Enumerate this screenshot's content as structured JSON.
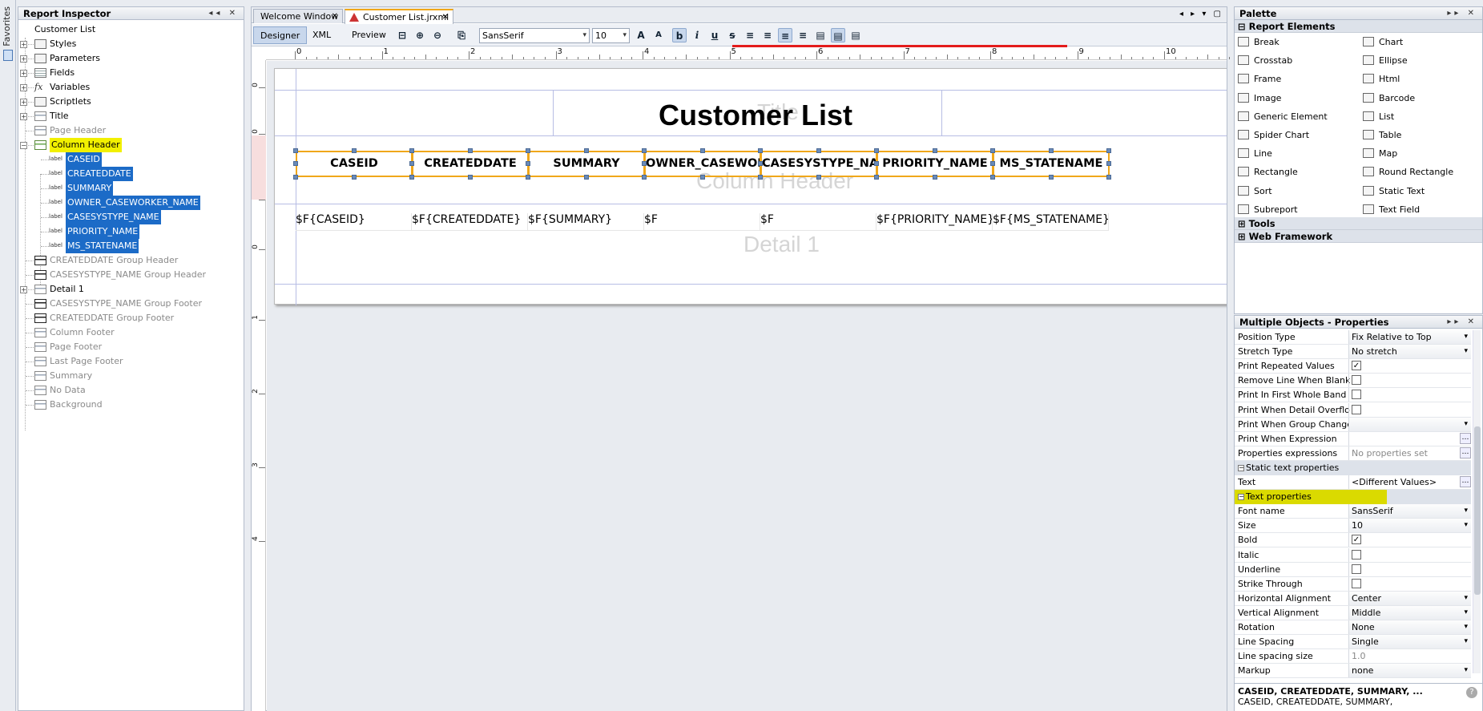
{
  "favorites": {
    "label": "Favorites"
  },
  "inspector": {
    "title": "Report Inspector",
    "items": [
      {
        "label": "Customer List"
      },
      {
        "label": "Styles"
      },
      {
        "label": "Parameters"
      },
      {
        "label": "Fields"
      },
      {
        "label": "Variables"
      },
      {
        "label": "Scriptlets"
      },
      {
        "label": "Title"
      },
      {
        "label": "Page Header"
      },
      {
        "label": "Column Header"
      },
      {
        "label": "CASEID"
      },
      {
        "label": "CREATEDDATE"
      },
      {
        "label": "SUMMARY"
      },
      {
        "label": "OWNER_CASEWORKER_NAME"
      },
      {
        "label": "CASESYSTYPE_NAME"
      },
      {
        "label": "PRIORITY_NAME"
      },
      {
        "label": "MS_STATENAME"
      },
      {
        "label": "CREATEDDATE Group Header"
      },
      {
        "label": "CASESYSTYPE_NAME Group Header"
      },
      {
        "label": "Detail 1"
      },
      {
        "label": "CASESYSTYPE_NAME Group Footer"
      },
      {
        "label": "CREATEDDATE Group Footer"
      },
      {
        "label": "Column Footer"
      },
      {
        "label": "Page Footer"
      },
      {
        "label": "Last Page Footer"
      },
      {
        "label": "Summary"
      },
      {
        "label": "No Data"
      },
      {
        "label": "Background"
      }
    ],
    "element_type_label": "label",
    "fx_label": "fx"
  },
  "editor": {
    "tabs": [
      {
        "label": "Welcome Window"
      },
      {
        "label": "Customer List.jrxml"
      }
    ],
    "modes": {
      "designer": "Designer",
      "xml": "XML",
      "preview": "Preview"
    },
    "font_name": "SansSerif",
    "font_size": "10",
    "ruler_h": [
      "0",
      "1",
      "2",
      "3",
      "4",
      "5",
      "6",
      "7",
      "8",
      "9",
      "10"
    ],
    "ruler_v": [
      "0",
      "0",
      "0",
      "0",
      "1",
      "2",
      "3",
      "4"
    ],
    "report_title": "Customer List",
    "watermarks": {
      "title": "Title",
      "column_header": "Column Header",
      "detail": "Detail 1"
    },
    "column_headers": [
      "CASEID",
      "CREATEDDATE",
      "SUMMARY",
      "OWNER_CASEWORKER_NAME",
      "CASESYSTYPE_NAME",
      "PRIORITY_NAME",
      "MS_STATENAME"
    ],
    "detail_fields": [
      "$F{CASEID}",
      "$F{CREATEDDATE}",
      "$F{SUMMARY}",
      "$F",
      "$F",
      "$F{PRIORITY_NAME}",
      "$F{MS_STATENAME}"
    ]
  },
  "palette": {
    "title": "Palette",
    "category": "Report Elements",
    "items": [
      {
        "label": "Break",
        "icon": "break-icon"
      },
      {
        "label": "Chart",
        "icon": "chart-icon"
      },
      {
        "label": "Crosstab",
        "icon": "crosstab-icon"
      },
      {
        "label": "Ellipse",
        "icon": "ellipse-icon"
      },
      {
        "label": "Frame",
        "icon": "frame-icon"
      },
      {
        "label": "Html",
        "icon": "html-icon"
      },
      {
        "label": "Image",
        "icon": "image-icon"
      },
      {
        "label": "Barcode",
        "icon": "barcode-icon"
      },
      {
        "label": "Generic Element",
        "icon": "generic-element-icon"
      },
      {
        "label": "List",
        "icon": "list-icon"
      },
      {
        "label": "Spider Chart",
        "icon": "spider-chart-icon"
      },
      {
        "label": "Table",
        "icon": "table-icon"
      },
      {
        "label": "Line",
        "icon": "line-icon"
      },
      {
        "label": "Map",
        "icon": "map-icon"
      },
      {
        "label": "Rectangle",
        "icon": "rectangle-icon"
      },
      {
        "label": "Round Rectangle",
        "icon": "round-rectangle-icon"
      },
      {
        "label": "Sort",
        "icon": "sort-icon"
      },
      {
        "label": "Static Text",
        "icon": "static-text-icon"
      },
      {
        "label": "Subreport",
        "icon": "subreport-icon"
      },
      {
        "label": "Text Field",
        "icon": "text-field-icon"
      }
    ],
    "tools": "Tools",
    "web_framework": "Web Framework"
  },
  "properties": {
    "title": "Multiple Objects - Properties",
    "rows": [
      {
        "name": "Position Type",
        "value": "Fix Relative to Top",
        "kind": "combo"
      },
      {
        "name": "Stretch Type",
        "value": "No stretch",
        "kind": "combo"
      },
      {
        "name": "Print Repeated Values",
        "checked": true,
        "kind": "check"
      },
      {
        "name": "Remove Line When Blank",
        "checked": false,
        "kind": "check"
      },
      {
        "name": "Print In First Whole Band",
        "checked": false,
        "kind": "check"
      },
      {
        "name": "Print When Detail Overflows",
        "checked": false,
        "kind": "check"
      },
      {
        "name": "Print When Group Changes",
        "value": "",
        "kind": "combo"
      },
      {
        "name": "Print When Expression",
        "value": "",
        "kind": "dots"
      },
      {
        "name": "Properties expressions",
        "value": "No properties set",
        "kind": "dots"
      },
      {
        "name": "Static text properties",
        "kind": "section"
      },
      {
        "name": "Text",
        "value": "<Different Values>",
        "kind": "dots"
      },
      {
        "name": "Text properties",
        "kind": "section"
      },
      {
        "name": "Font name",
        "value": "SansSerif",
        "kind": "combo"
      },
      {
        "name": "Size",
        "value": "10",
        "kind": "combo"
      },
      {
        "name": "Bold",
        "checked": true,
        "kind": "check"
      },
      {
        "name": "Italic",
        "checked": false,
        "kind": "check"
      },
      {
        "name": "Underline",
        "checked": false,
        "kind": "check"
      },
      {
        "name": "Strike Through",
        "checked": false,
        "kind": "check"
      },
      {
        "name": "Horizontal Alignment",
        "value": "Center",
        "kind": "combo"
      },
      {
        "name": "Vertical Alignment",
        "value": "Middle",
        "kind": "combo"
      },
      {
        "name": "Rotation",
        "value": "None",
        "kind": "combo"
      },
      {
        "name": "Line Spacing",
        "value": "Single",
        "kind": "combo"
      },
      {
        "name": "Line spacing size",
        "value": "1.0",
        "kind": "text"
      },
      {
        "name": "Markup",
        "value": "none",
        "kind": "combo"
      }
    ],
    "description_title": "CASEID, CREATEDDATE, SUMMARY, ...",
    "description_text": "CASEID, CREATEDDATE, SUMMARY,"
  },
  "colors": {
    "highlight": "#f2f000",
    "selection": "#1c6bc7",
    "element_border": "#f0a71a",
    "annotation_red": "#e31b1b"
  }
}
